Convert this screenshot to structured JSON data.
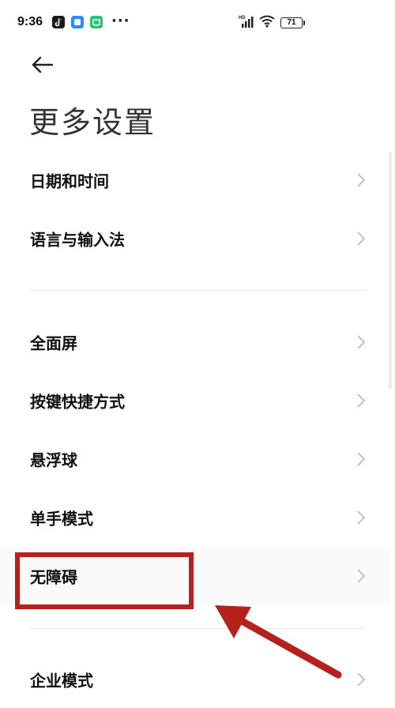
{
  "status_bar": {
    "time": "9:36",
    "more_indicator": "···",
    "network_label": "HD",
    "battery_level": "71",
    "app_icons": [
      "tiktok-icon",
      "blue-app-icon",
      "green-app-icon"
    ]
  },
  "header": {
    "back_icon": "back-arrow-icon",
    "title": "更多设置"
  },
  "list": {
    "items": [
      {
        "label": "日期和时间"
      },
      {
        "label": "语言与输入法"
      },
      {
        "label": "全面屏"
      },
      {
        "label": "按键快捷方式"
      },
      {
        "label": "悬浮球"
      },
      {
        "label": "单手模式"
      },
      {
        "label": "无障碍"
      },
      {
        "label": "企业模式"
      }
    ]
  },
  "annotation": {
    "highlight_color": "#b5211c",
    "target": "无障碍"
  },
  "colors": {
    "background": "#ffffff",
    "text": "#111111",
    "chevron": "#bbbbbb",
    "annotation": "#b5211c"
  }
}
